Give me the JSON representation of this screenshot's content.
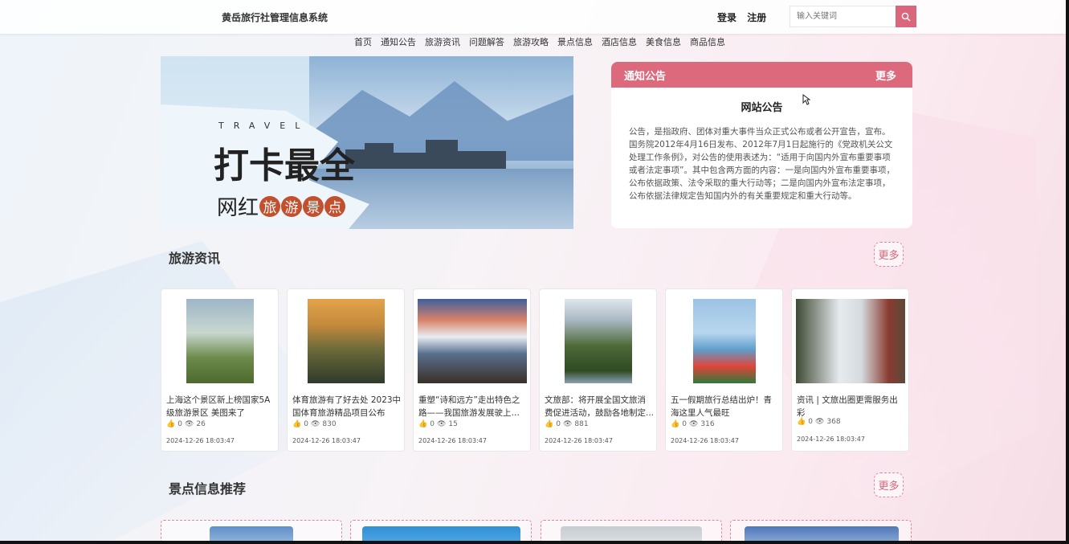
{
  "header": {
    "site_title": "黄岳旅行社管理信息系统",
    "login": "登录",
    "register": "注册",
    "search_placeholder": "输入关键词"
  },
  "nav": [
    "首页",
    "通知公告",
    "旅游资讯",
    "问题解答",
    "旅游攻略",
    "景点信息",
    "酒店信息",
    "美食信息",
    "商品信息"
  ],
  "banner": {
    "travel": "TRAVEL",
    "headline": "打卡最全",
    "sub_prefix": "网红",
    "sub_circles": [
      "旅",
      "游",
      "景",
      "点"
    ]
  },
  "notice": {
    "header": "通知公告",
    "more": "更多",
    "title": "网站公告",
    "body": "公告，是指政府、团体对重大事件当众正式公布或者公开宣告，宣布。国务院2012年4月16日发布、2012年7月1日起施行的《党政机关公文处理工作条例》，对公告的使用表述为：“适用于向国内外宣布重要事项或者法定事项”。其中包含两方面的内容：一是向国内外宣布重要事项，公布依据政策、法令采取的重大行动等；二是向国内外宣布法定事项，公布依据法律规定告知国内外的有关重要规定和重大行动等。"
  },
  "news": {
    "title": "旅游资讯",
    "more": "更多",
    "items": [
      {
        "title": "上海这个景区新上榜国家5A级旅游景区 美图来了",
        "likes": "0",
        "views": "26",
        "date": "2024-12-26 18:03:47"
      },
      {
        "title": "体育旅游有了好去处 2023中国体育旅游精品项目公布",
        "likes": "0",
        "views": "830",
        "date": "2024-12-26 18:03:47"
      },
      {
        "title": "重塑“诗和远方”走出特色之路——我国旅游发展驶上快车道",
        "likes": "0",
        "views": "15",
        "date": "2024-12-26 18:03:47"
      },
      {
        "title": "文旅部：将开展全国文旅消费促进活动，鼓励各地制定...",
        "likes": "0",
        "views": "881",
        "date": "2024-12-26 18:03:47"
      },
      {
        "title": "五一假期旅行总结出炉！青海这里人气最旺",
        "likes": "0",
        "views": "316",
        "date": "2024-12-26 18:03:47"
      },
      {
        "title": "资讯 | 文旅出圈更需服务出彩",
        "likes": "0",
        "views": "368",
        "date": "2024-12-26 18:03:47"
      }
    ]
  },
  "scenic": {
    "title": "景点信息推荐",
    "more": "更多"
  },
  "colors": {
    "accent": "#d9667a",
    "notice_header": "#dd6a7c"
  }
}
